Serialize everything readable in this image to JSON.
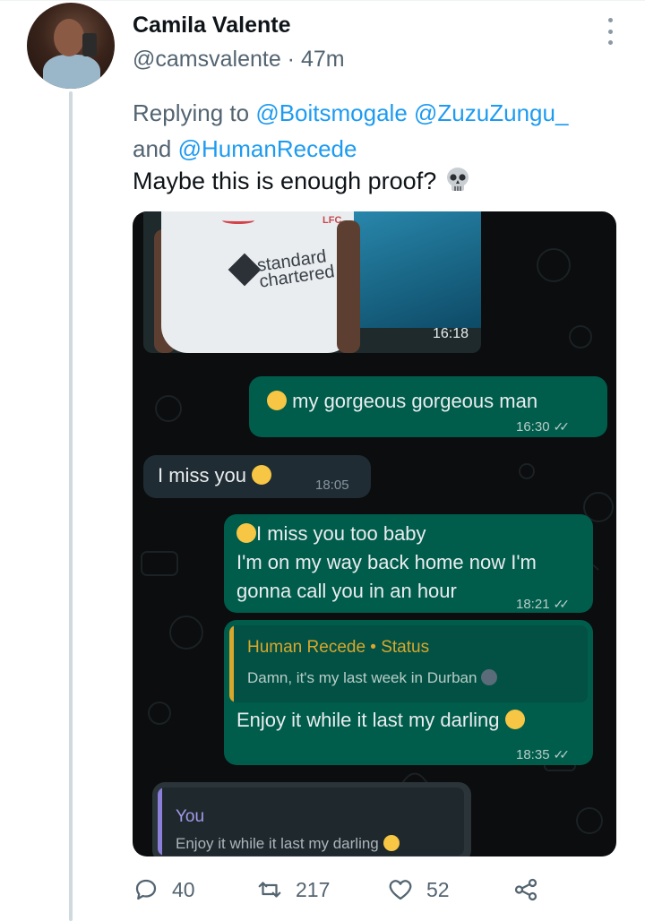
{
  "tweet": {
    "author_name": "Camila Valente",
    "handle_line": "@camsvalente · 47m",
    "replying_prefix": "Replying to",
    "mentions": [
      "@Boitsmogale",
      "@ZuzuZungu_",
      "@HumanRecede"
    ],
    "mention_joiner": "and",
    "text": "Maybe this is enough proof?"
  },
  "media": {
    "photo": {
      "timestamp": "16:18",
      "sponsor_line1": "standard",
      "sponsor_line2": "chartered",
      "crest_text": "LFC"
    },
    "messages": [
      {
        "direction": "outgoing",
        "text": "my gorgeous gorgeous man",
        "time": "16:30"
      },
      {
        "direction": "incoming",
        "text": "I miss you",
        "time": "18:05"
      },
      {
        "direction": "outgoing",
        "line1": "I miss you too baby",
        "line2": "I'm on my way back home now I'm",
        "line3": "gonna call you in an hour",
        "time": "18:21"
      },
      {
        "direction": "outgoing",
        "quote_name": "Human Recede • Status",
        "quote_text": "Damn, it's my last week in Durban",
        "text": "Enjoy it while it last my darling",
        "time": "18:35"
      },
      {
        "direction": "outgoing",
        "quote_name": "You",
        "quote_text": "Enjoy it while it last my darling"
      }
    ]
  },
  "actions": {
    "replies": "40",
    "retweets": "217",
    "likes": "52"
  },
  "icons": {
    "reply": "reply-icon",
    "retweet": "retweet-icon",
    "like": "heart-icon",
    "share": "share-icon",
    "more": "more-dots-icon"
  },
  "colors": {
    "link": "#1d9bf0",
    "muted": "#536471",
    "outgoing_bubble": "#005c4b",
    "incoming_bubble": "#202c33",
    "status_name": "#d9a72c"
  }
}
